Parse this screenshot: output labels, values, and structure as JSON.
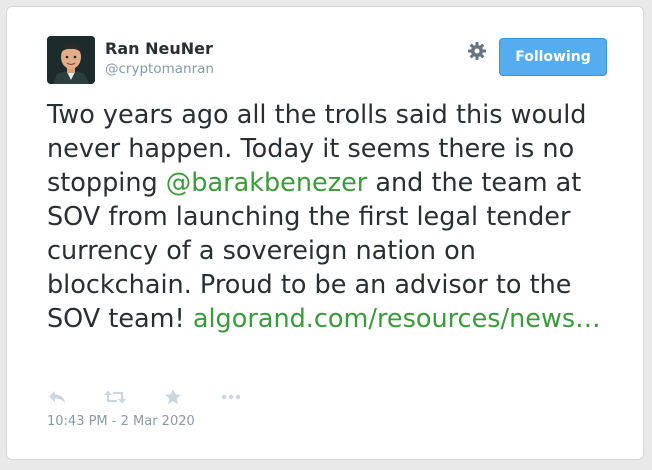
{
  "author": {
    "display_name": "Ran NeuNer",
    "username": "@cryptomanran",
    "avatar_icon": "user-avatar"
  },
  "follow_button": {
    "label": "Following",
    "color": "#55acee"
  },
  "settings_icon": "gear-icon",
  "tweet": {
    "text_part1": "Two years ago all the trolls said this would never happen. Today it seems there is no stopping ",
    "mention": "@barakbenezer",
    "text_part2": " and the team at SOV from launching the first legal tender currency of a sovereign nation on blockchain. Proud to be an advisor to the SOV team! ",
    "link": "algorand.com/resources/news…",
    "link_color": "#3c9a3c"
  },
  "actions": [
    "reply-icon",
    "retweet-icon",
    "like-star-icon",
    "more-icon"
  ],
  "timestamp": "10:43 PM - 2 Mar 2020",
  "colors": {
    "text": "#292f33",
    "muted": "#8899a6",
    "action_icon": "#ccd6dd"
  }
}
